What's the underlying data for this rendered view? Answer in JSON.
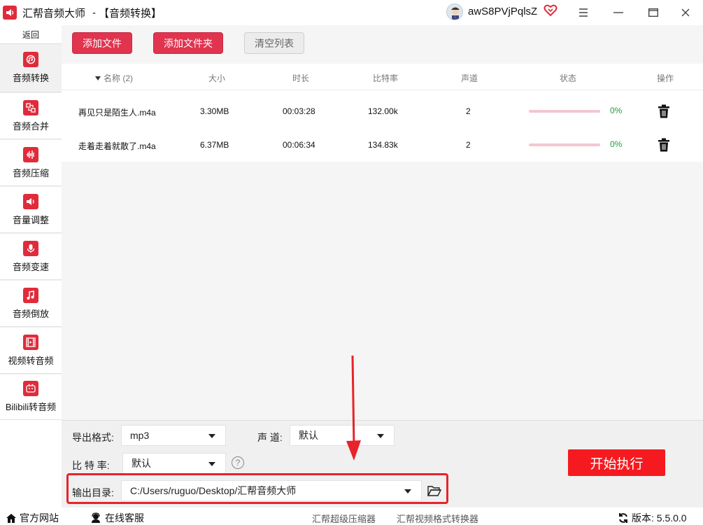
{
  "window": {
    "app_title": "汇帮音频大师",
    "separator": "-",
    "page_title": "【音频转换】",
    "username": "awS8PVjPqlsZ"
  },
  "sidebar": {
    "back_label": "返回",
    "items": [
      {
        "label": "音频转换",
        "icon": "audio-convert-icon",
        "active": true
      },
      {
        "label": "音频合并",
        "icon": "audio-merge-icon"
      },
      {
        "label": "音频压缩",
        "icon": "audio-compress-icon"
      },
      {
        "label": "音量调整",
        "icon": "volume-icon"
      },
      {
        "label": "音频变速",
        "icon": "microphone-icon"
      },
      {
        "label": "音频倒放",
        "icon": "music-note-icon"
      },
      {
        "label": "视频转音频",
        "icon": "film-icon"
      },
      {
        "label": "Bilibili转音频",
        "icon": "tv-icon"
      }
    ]
  },
  "toolbar": {
    "add_file": "添加文件",
    "add_folder": "添加文件夹",
    "clear_list": "清空列表"
  },
  "table": {
    "headers": {
      "name": "名称 (2)",
      "size": "大小",
      "duration": "时长",
      "bitrate": "比特率",
      "channels": "声道",
      "status": "状态",
      "action": "操作"
    },
    "rows": [
      {
        "name": "再见只是陌生人.m4a",
        "size": "3.30MB",
        "duration": "00:03:28",
        "bitrate": "132.00k",
        "channels": "2",
        "progress_text": "0%"
      },
      {
        "name": "走着走着就散了.m4a",
        "size": "6.37MB",
        "duration": "00:06:34",
        "bitrate": "134.83k",
        "channels": "2",
        "progress_text": "0%"
      }
    ]
  },
  "settings": {
    "format_label": "导出格式:",
    "format_value": "mp3",
    "channel_label": "声 道:",
    "channel_value": "默认",
    "bitrate_label": "比 特 率:",
    "bitrate_value": "默认",
    "help_glyph": "?",
    "output_label": "输出目录:",
    "output_value": "C:/Users/ruguo/Desktop/汇帮音频大师",
    "start_label": "开始执行"
  },
  "footer": {
    "official_site": "官方网站",
    "online_service": "在线客服",
    "link1": "汇帮超级压缩器",
    "link2": "汇帮视频格式转换器",
    "version": "版本: 5.5.0.0"
  },
  "colors": {
    "brand_red": "#e02b3b",
    "button_red": "#e0344f",
    "start_red": "#f51a1f",
    "progress_track": "#f4c6d0",
    "progress_text": "#21a040",
    "annotation_red": "#e8232a"
  }
}
